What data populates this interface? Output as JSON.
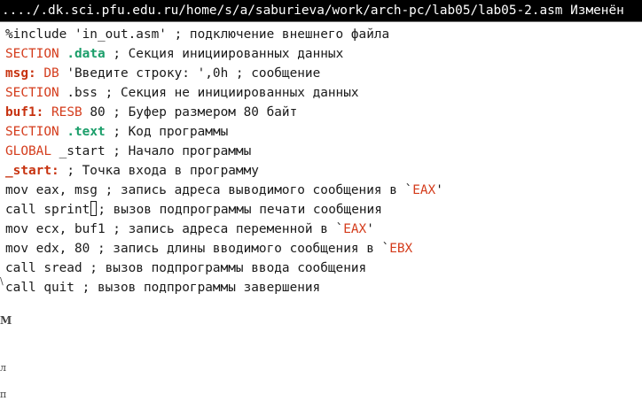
{
  "window": {
    "title": "..../.dk.sci.pfu.edu.ru/home/s/a/saburieva/work/arch-pc/lab05/lab05-2.asm Изменён"
  },
  "editor": {
    "lines": [
      [
        {
          "t": "%include 'in_out.asm' ; подключение внешнего файла",
          "c": "plain"
        }
      ],
      [
        {
          "t": "SECTION",
          "c": "kw"
        },
        {
          "t": " ",
          "c": "plain"
        },
        {
          "t": ".data",
          "c": "sec"
        },
        {
          "t": " ; Секция инициированных данных",
          "c": "plain"
        }
      ],
      [
        {
          "t": "msg:",
          "c": "lbl"
        },
        {
          "t": " ",
          "c": "plain"
        },
        {
          "t": "DB",
          "c": "kw"
        },
        {
          "t": " 'Введите строку: ',0h ; сообщение",
          "c": "plain"
        }
      ],
      [
        {
          "t": "SECTION",
          "c": "kw"
        },
        {
          "t": " .bss ; Секция не инициированных данных",
          "c": "plain"
        }
      ],
      [
        {
          "t": "buf1:",
          "c": "lbl"
        },
        {
          "t": " ",
          "c": "plain"
        },
        {
          "t": "RESB",
          "c": "kw"
        },
        {
          "t": " 80 ; Буфер размером 80 байт",
          "c": "plain"
        }
      ],
      [
        {
          "t": "SECTION",
          "c": "kw"
        },
        {
          "t": " ",
          "c": "plain"
        },
        {
          "t": ".text",
          "c": "sec"
        },
        {
          "t": " ; Код программы",
          "c": "plain"
        }
      ],
      [
        {
          "t": "GLOBAL",
          "c": "kw"
        },
        {
          "t": " _start ; Начало программы",
          "c": "plain"
        }
      ],
      [
        {
          "t": "_start:",
          "c": "lbl"
        },
        {
          "t": " ; Точка входа в программу",
          "c": "plain"
        }
      ],
      [
        {
          "t": "mov eax, msg ; запись адреса выводимого сообщения в `",
          "c": "plain"
        },
        {
          "t": "EAX",
          "c": "kw"
        },
        {
          "t": "'",
          "c": "plain"
        }
      ],
      [
        {
          "t": "call sprint",
          "c": "plain"
        },
        {
          "t": "",
          "c": "cursor"
        },
        {
          "t": "; вызов подпрограммы печати сообщения",
          "c": "plain"
        }
      ],
      [
        {
          "t": "mov ecx, buf1 ; запись адреса переменной в `",
          "c": "plain"
        },
        {
          "t": "EAX",
          "c": "kw"
        },
        {
          "t": "'",
          "c": "plain"
        }
      ],
      [
        {
          "t": "mov edx, 80 ; запись длины вводимого сообщения в `",
          "c": "plain"
        },
        {
          "t": "EBX",
          "c": "kw"
        }
      ],
      [
        {
          "t": "call sread ; вызов подпрограммы ввода сообщения",
          "c": "plain"
        }
      ],
      [
        {
          "t": "call quit ; вызов подпрограммы завершения",
          "c": "plain"
        }
      ]
    ]
  },
  "background_fragments": [
    "\\",
    "M",
    "л",
    "п"
  ]
}
